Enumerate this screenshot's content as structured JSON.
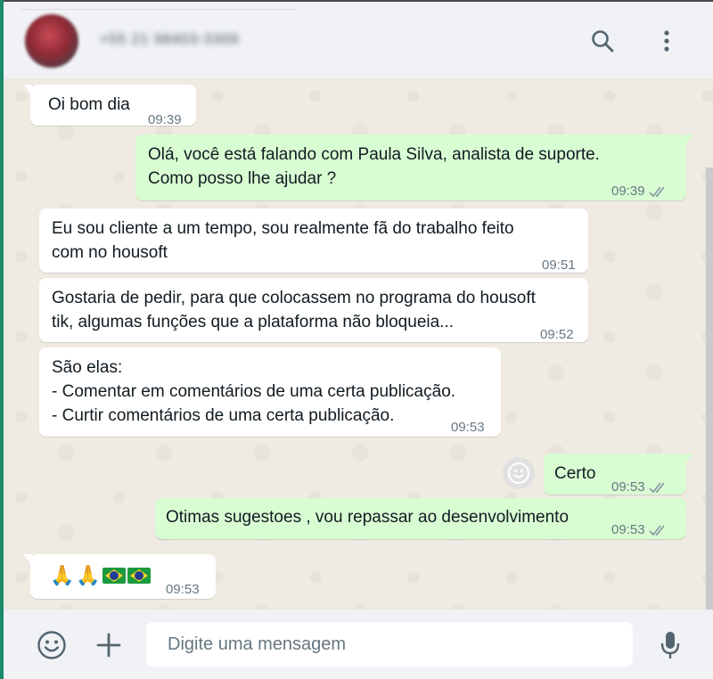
{
  "header": {
    "contact_name": "+55 21 98403-3309",
    "search_icon": "search-icon",
    "menu_icon": "kebab-menu-icon"
  },
  "messages": [
    {
      "direction": "in",
      "text": "Oi bom dia",
      "time": "09:39"
    },
    {
      "direction": "out",
      "text": "Olá, você está falando com Paula Silva, analista de suporte.\nComo posso lhe ajudar ?",
      "time": "09:39",
      "status": "read"
    },
    {
      "direction": "in",
      "text": "Eu sou cliente a um tempo, sou realmente fã do trabalho feito\ncom no housoft",
      "time": "09:51"
    },
    {
      "direction": "in",
      "text": "Gostaria de pedir, para que colocassem no programa do housoft\ntik, algumas funções que a plataforma não bloqueia...",
      "time": "09:52"
    },
    {
      "direction": "in",
      "text": "São elas:\n- Comentar em comentários de uma certa publicação.\n- Curtir comentários de uma certa publicação.",
      "time": "09:53"
    },
    {
      "direction": "out",
      "text": "Certo",
      "time": "09:53",
      "status": "read"
    },
    {
      "direction": "out",
      "text": "Otimas sugestoes , vou repassar ao desenvolvimento",
      "time": "09:53",
      "status": "read"
    },
    {
      "direction": "in",
      "text": "🙏🙏🇧🇷🇧🇷",
      "time": "09:53"
    }
  ],
  "footer": {
    "placeholder": "Digite uma mensagem",
    "emoji_icon": "emoji-icon",
    "attach_icon": "plus-icon",
    "mic_icon": "microphone-icon"
  },
  "colors": {
    "incoming_bubble": "#ffffff",
    "outgoing_bubble": "#d9fdd3",
    "chat_background": "#efeae2",
    "header_background": "#f0f2f5",
    "tick_color": "#8696a0",
    "accent": "#1d8a6c"
  }
}
